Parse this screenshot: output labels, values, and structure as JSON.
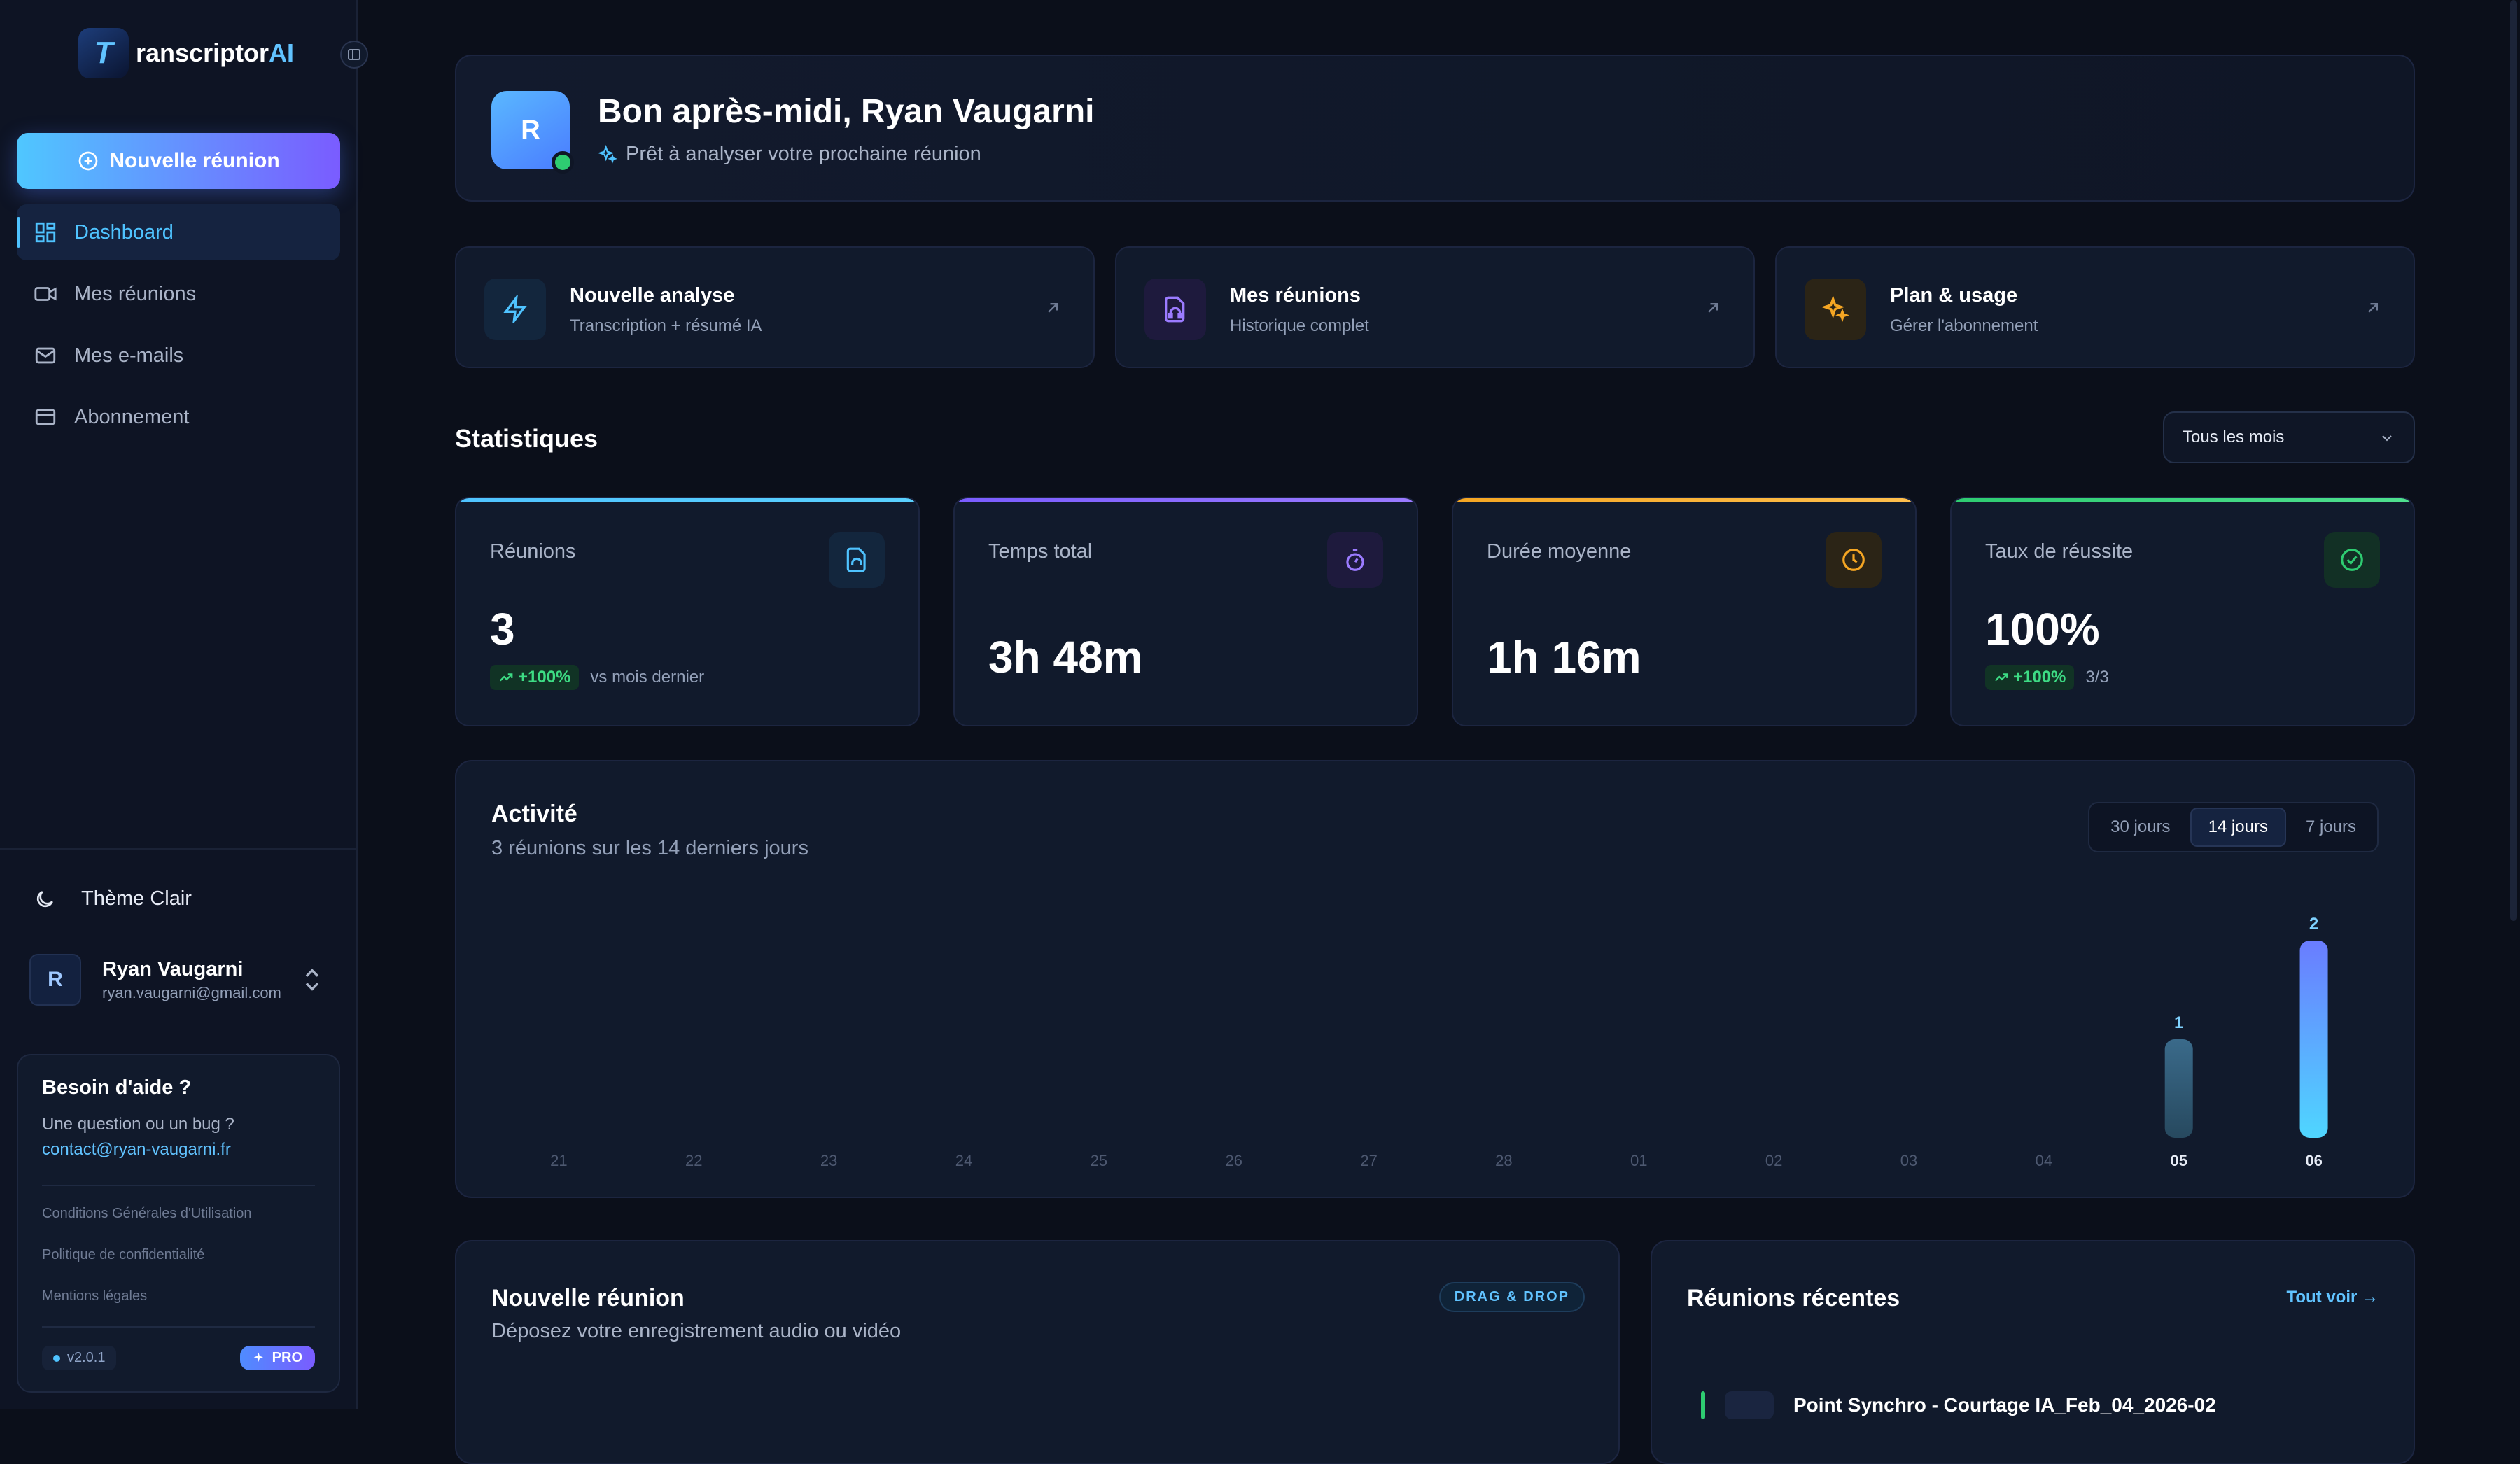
{
  "app": {
    "logo_letter": "T",
    "logo_name_main": "ranscriptor",
    "logo_name_accent": "AI",
    "accent": "#4fc3ff"
  },
  "sidebar": {
    "new_meeting_label": "Nouvelle réunion",
    "items": [
      {
        "label": "Dashboard",
        "icon": "dashboard-icon",
        "active": true
      },
      {
        "label": "Mes réunions",
        "icon": "video-icon",
        "active": false
      },
      {
        "label": "Mes e-mails",
        "icon": "mail-icon",
        "active": false
      },
      {
        "label": "Abonnement",
        "icon": "card-icon",
        "active": false
      }
    ],
    "theme_label": "Thème Clair",
    "user": {
      "initial": "R",
      "name": "Ryan Vaugarni",
      "email": "ryan.vaugarni@gmail.com"
    },
    "help": {
      "title": "Besoin d'aide ?",
      "text": "Une question ou un bug ?",
      "email": "contact@ryan-vaugarni.fr",
      "links": [
        "Conditions Générales d'Utilisation",
        "Politique de confidentialité",
        "Mentions légales"
      ],
      "version": "v2.0.1",
      "plan": "PRO"
    }
  },
  "welcome": {
    "initial": "R",
    "title": "Bon après-midi, Ryan Vaugarni",
    "subtitle": "Prêt à analyser votre prochaine réunion"
  },
  "quick_actions": [
    {
      "title": "Nouvelle analyse",
      "subtitle": "Transcription + résumé IA",
      "icon": "bolt-icon",
      "color": "#4fc3ff"
    },
    {
      "title": "Mes réunions",
      "subtitle": "Historique complet",
      "icon": "file-audio-icon",
      "color": "#9b7bff"
    },
    {
      "title": "Plan & usage",
      "subtitle": "Gérer l'abonnement",
      "icon": "sparkles-icon",
      "color": "#f5a623"
    }
  ],
  "stats": {
    "title": "Statistiques",
    "period": "Tous les mois",
    "cards": [
      {
        "label": "Réunions",
        "value": "3",
        "trend": "+100%",
        "note": "vs mois dernier",
        "color": "#4fc3ff",
        "icon": "file-audio-icon"
      },
      {
        "label": "Temps total",
        "value": "3h 48m",
        "trend": "",
        "note": "",
        "color": "#7a5cff",
        "icon": "timer-icon"
      },
      {
        "label": "Durée moyenne",
        "value": "1h 16m",
        "trend": "",
        "note": "",
        "color": "#f5a623",
        "icon": "clock-icon"
      },
      {
        "label": "Taux de réussite",
        "value": "100%",
        "trend": "+100%",
        "note": "3/3",
        "color": "#2ecc71",
        "icon": "check-circle-icon"
      }
    ]
  },
  "activity": {
    "title": "Activité",
    "subtitle": "3 réunions sur les 14 derniers jours",
    "tabs": [
      "30 jours",
      "14 jours",
      "7 jours"
    ],
    "active_tab": 1
  },
  "chart_data": {
    "type": "bar",
    "categories": [
      "21",
      "22",
      "23",
      "24",
      "25",
      "26",
      "27",
      "28",
      "01",
      "02",
      "03",
      "04",
      "05",
      "06"
    ],
    "values": [
      0,
      0,
      0,
      0,
      0,
      0,
      0,
      0,
      0,
      0,
      0,
      0,
      1,
      2
    ],
    "title": "Activité",
    "ylim": [
      0,
      2
    ]
  },
  "upload": {
    "title": "Nouvelle réunion",
    "subtitle": "Déposez votre enregistrement audio ou vidéo",
    "badge": "DRAG & DROP"
  },
  "recent": {
    "title": "Réunions récentes",
    "link": "Tout voir →",
    "first_item": "Point Synchro - Courtage IA_Feb_04_2026-02"
  }
}
